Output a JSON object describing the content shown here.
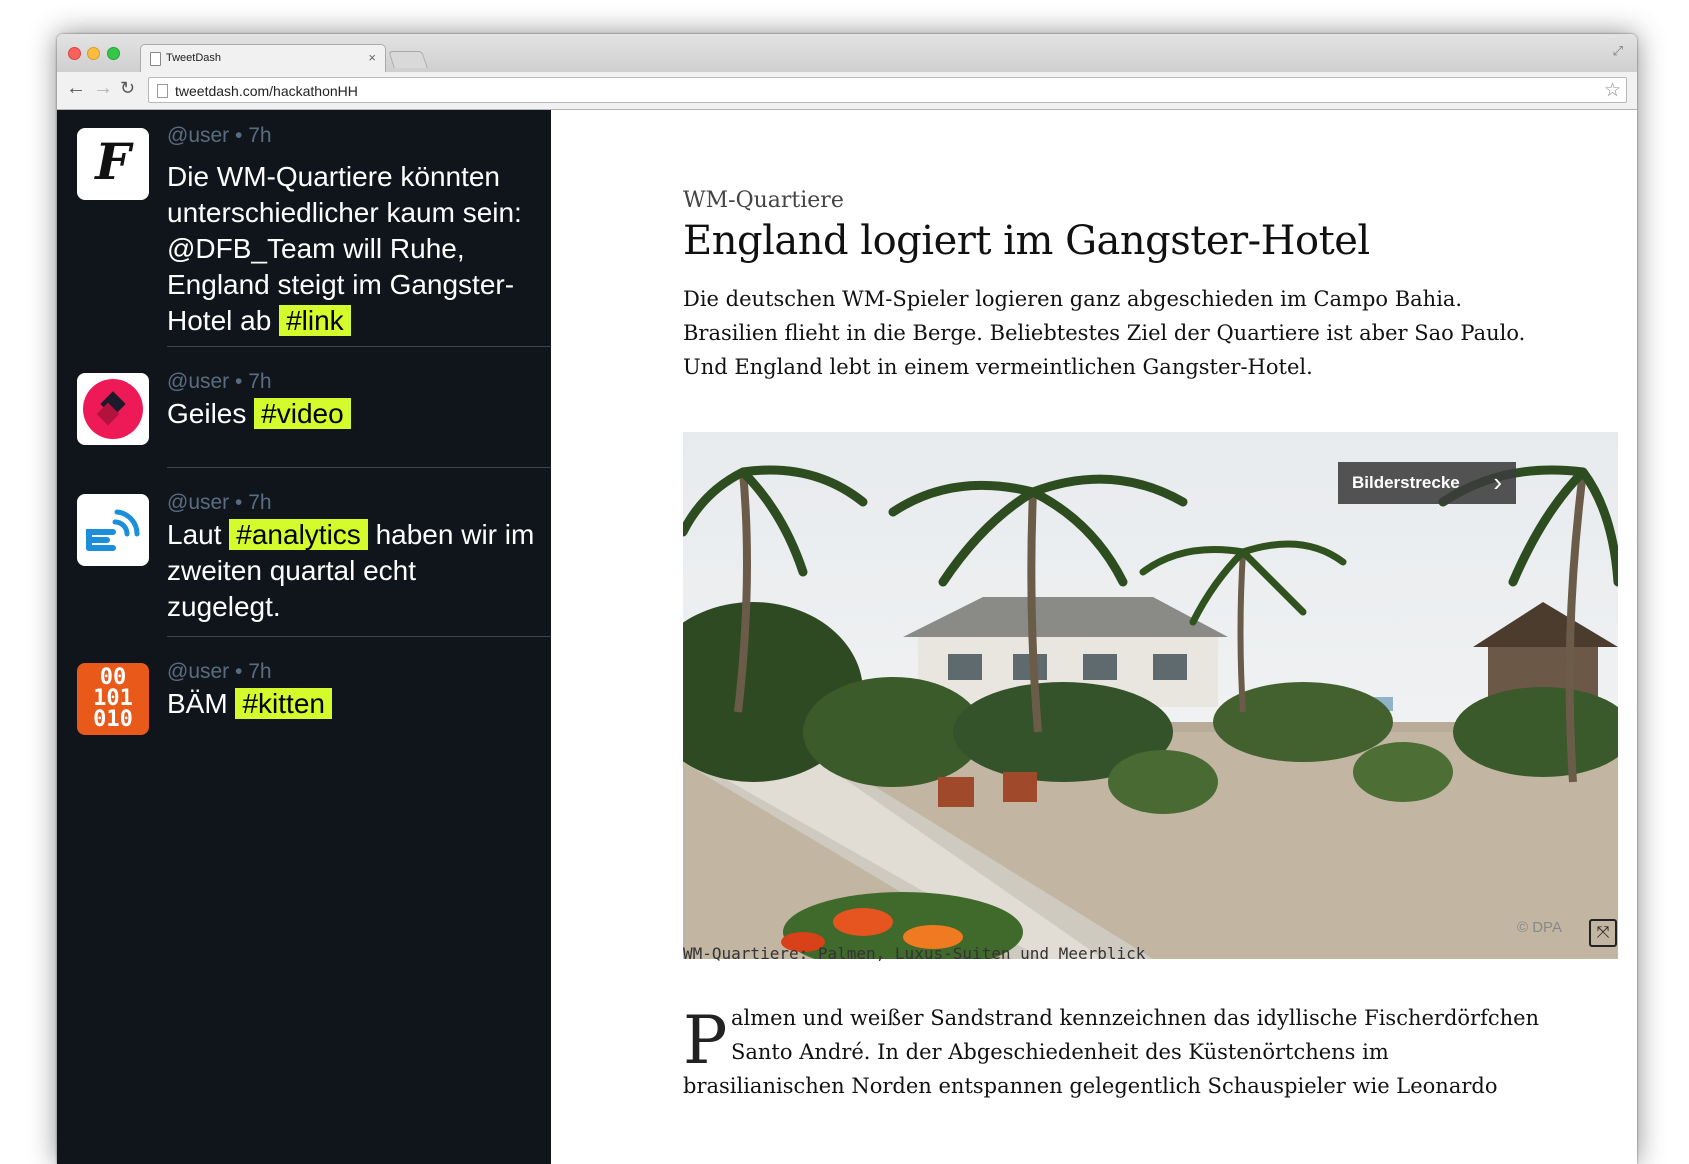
{
  "browser": {
    "tab_title": "TweetDash",
    "tab_close": "×",
    "url": "tweetdash.com/hackathonHH",
    "back_glyph": "←",
    "forward_glyph": "→",
    "reload_glyph": "↻",
    "star_glyph": "☆",
    "fullscreen_glyph": "⤢"
  },
  "tweets": [
    {
      "handle": "@user",
      "time": "7h",
      "avatar": "faz-logo-icon",
      "avatar_glyph": "F",
      "text": "Die WM-Quartiere könnten unterschiedlicher kaum sein: @DFB_Team will Ruhe, England steigt im Gangster-Hotel ab",
      "tag": "#link"
    },
    {
      "handle": "@user",
      "time": "7h",
      "avatar": "video-logo-icon",
      "text": "Geiles",
      "tag": "#video"
    },
    {
      "handle": "@user",
      "time": "7h",
      "avatar": "analytics-logo-icon",
      "text_before": "Laut",
      "tag": "#analytics",
      "text_after": "haben wir im zweiten quartal echt zugelegt."
    },
    {
      "handle": "@user",
      "time": "7h",
      "avatar": "binary-logo-icon",
      "avatar_lines": [
        "00",
        "101",
        "010"
      ],
      "text": "BÄM",
      "tag": "#kitten"
    }
  ],
  "meta_separator": "•",
  "article": {
    "kicker": "WM-Quartiere",
    "headline": "England logiert im Gangster-Hotel",
    "lead": "Die deutschen WM-Spieler logieren ganz abgeschieden im Campo Bahia. Brasilien flieht in die Berge. Beliebtestes Ziel der Quartiere ist aber Sao Paulo. Und England lebt in einem vermeintlichen Gangster-Hotel.",
    "gallery_label": "Bilderstrecke",
    "gallery_chevron": "›",
    "credit": "© DPA",
    "expand_glyph": "⤧",
    "caption": "WM-Quartiere: Palmen, Luxus-Suiten und Meerblick",
    "drop_cap": "P",
    "body_line_1": "almen und weißer Sandstrand kennzeichnen das idyllische Fischerdörfchen",
    "body_line_2": "Santo André. In der Abgeschiedenheit des Küstenörtchens im",
    "body_line_3": "brasilianischen Norden entspannen gelegentlich Schauspieler wie Leonardo"
  },
  "colors": {
    "sidebar_bg": "#10151c",
    "hashtag_bg": "#d4fb2b",
    "meta": "#5b6c80",
    "accent_pink": "#ee1a57",
    "accent_orange": "#e8591a",
    "accent_blue": "#1b8fd9"
  }
}
